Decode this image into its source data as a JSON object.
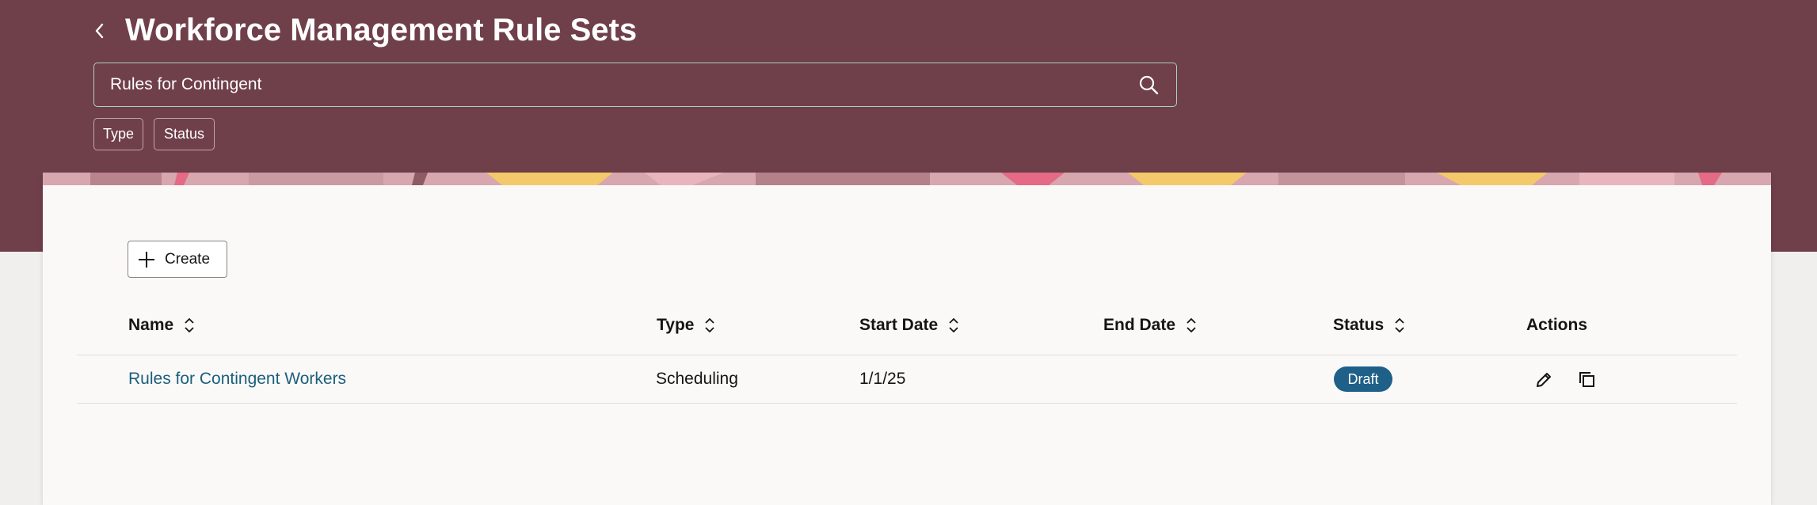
{
  "header": {
    "title": "Workforce Management Rule Sets",
    "back_icon": "chevron-left-icon"
  },
  "search": {
    "value": "Rules for Contingent",
    "icon": "search-icon"
  },
  "filters": [
    {
      "label": "Type"
    },
    {
      "label": "Status"
    }
  ],
  "toolbar": {
    "create_label": "Create",
    "create_icon": "plus-icon"
  },
  "table": {
    "columns": {
      "name": "Name",
      "type": "Type",
      "start_date": "Start Date",
      "end_date": "End Date",
      "status": "Status",
      "actions": "Actions"
    },
    "rows": [
      {
        "name": "Rules for Contingent Workers",
        "type": "Scheduling",
        "start_date": "1/1/25",
        "end_date": "",
        "status": "Draft",
        "actions": [
          "edit-icon",
          "duplicate-icon"
        ]
      }
    ]
  },
  "colors": {
    "header_bg": "#6f3f4a",
    "page_bg": "#f1efed",
    "card_bg": "#faf9f8",
    "link": "#1b5f7c",
    "badge_bg": "#1e6088",
    "search_border": "#a9d3c6"
  }
}
